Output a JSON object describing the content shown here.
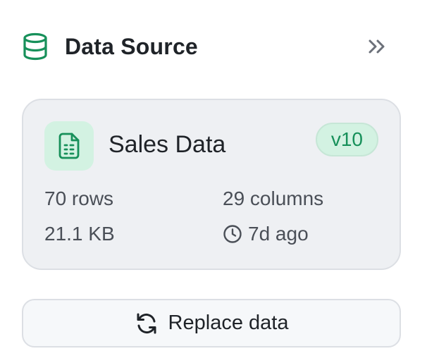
{
  "header": {
    "title": "Data Source",
    "icon": "database-icon",
    "collapse_icon": "chevrons-right-icon",
    "accent_color": "#17905a"
  },
  "dataset": {
    "name": "Sales Data",
    "icon": "spreadsheet-file-icon",
    "version": "v10",
    "rows": "70 rows",
    "columns": "29 columns",
    "size": "21.1 KB",
    "updated": "7d ago",
    "updated_icon": "clock-icon"
  },
  "actions": {
    "replace_label": "Replace data",
    "replace_icon": "refresh-icon"
  }
}
